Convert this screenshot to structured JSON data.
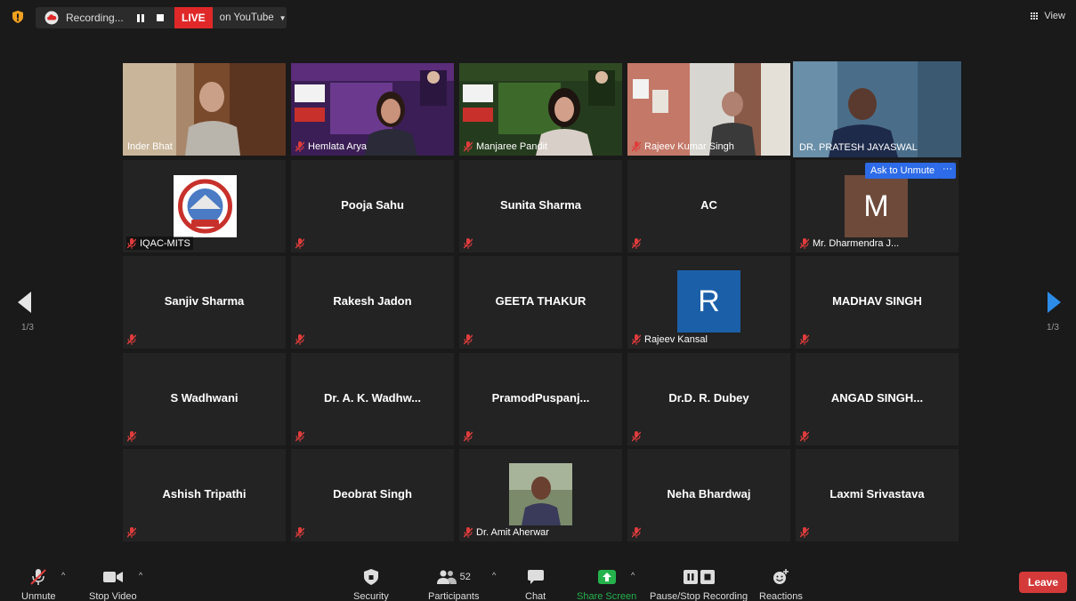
{
  "topbar": {
    "recording_label": "Recording...",
    "live_label": "LIVE",
    "stream_target": "on YouTube",
    "view_label": "View"
  },
  "tiles": [
    {
      "name": "Inder Bhat",
      "type": "video"
    },
    {
      "name": "Hemlata Arya",
      "type": "video"
    },
    {
      "name": "Manjaree Pandit",
      "type": "video"
    },
    {
      "name": "Rajeev Kumar Singh",
      "type": "video"
    },
    {
      "name": "DR. PRATESH JAYASWAL",
      "type": "video",
      "active_speaker": true
    },
    {
      "name": "IQAC-MITS",
      "type": "logo"
    },
    {
      "name": "Pooja Sahu",
      "type": "name"
    },
    {
      "name": "Sunita Sharma",
      "type": "name"
    },
    {
      "name": "AC",
      "type": "name"
    },
    {
      "name": "Mr. Dharmendra J...",
      "type": "avatar",
      "initial": "M"
    },
    {
      "name": "Sanjiv Sharma",
      "type": "name"
    },
    {
      "name": "Rakesh Jadon",
      "type": "name"
    },
    {
      "name": "GEETA THAKUR",
      "type": "name"
    },
    {
      "name": "Rajeev Kansal",
      "type": "avatar",
      "initial": "R"
    },
    {
      "name": "MADHAV SINGH",
      "type": "name"
    },
    {
      "name": "S Wadhwani",
      "type": "name"
    },
    {
      "name": "Dr. A. K. Wadhw...",
      "type": "name"
    },
    {
      "name": "PramodPuspanj...",
      "type": "name"
    },
    {
      "name": "Dr.D. R. Dubey",
      "type": "name"
    },
    {
      "name": "ANGAD SINGH...",
      "type": "name"
    },
    {
      "name": "Ashish Tripathi",
      "type": "name"
    },
    {
      "name": "Deobrat Singh",
      "type": "name"
    },
    {
      "name": "Dr. Amit Aherwar",
      "type": "photo"
    },
    {
      "name": "Neha Bhardwaj",
      "type": "name"
    },
    {
      "name": "Laxmi Srivastava",
      "type": "name"
    }
  ],
  "hover_controls": {
    "ask_to_unmute": "Ask to Unmute",
    "more": "···"
  },
  "pagination": {
    "left": "1/3",
    "right": "1/3"
  },
  "toolbar": {
    "unmute": "Unmute",
    "stop_video": "Stop Video",
    "security": "Security",
    "participants": "Participants",
    "participants_count": "52",
    "chat": "Chat",
    "share_screen": "Share Screen",
    "pause_stop_recording": "Pause/Stop Recording",
    "reactions": "Reactions",
    "leave": "Leave"
  },
  "colors": {
    "live_red": "#e02828",
    "leave_red": "#d43a3a",
    "share_green": "#25b24c",
    "accent_blue": "#2d6be8",
    "active_speaker_border": "#d6d96a",
    "mic_muted": "#e03c3c"
  }
}
